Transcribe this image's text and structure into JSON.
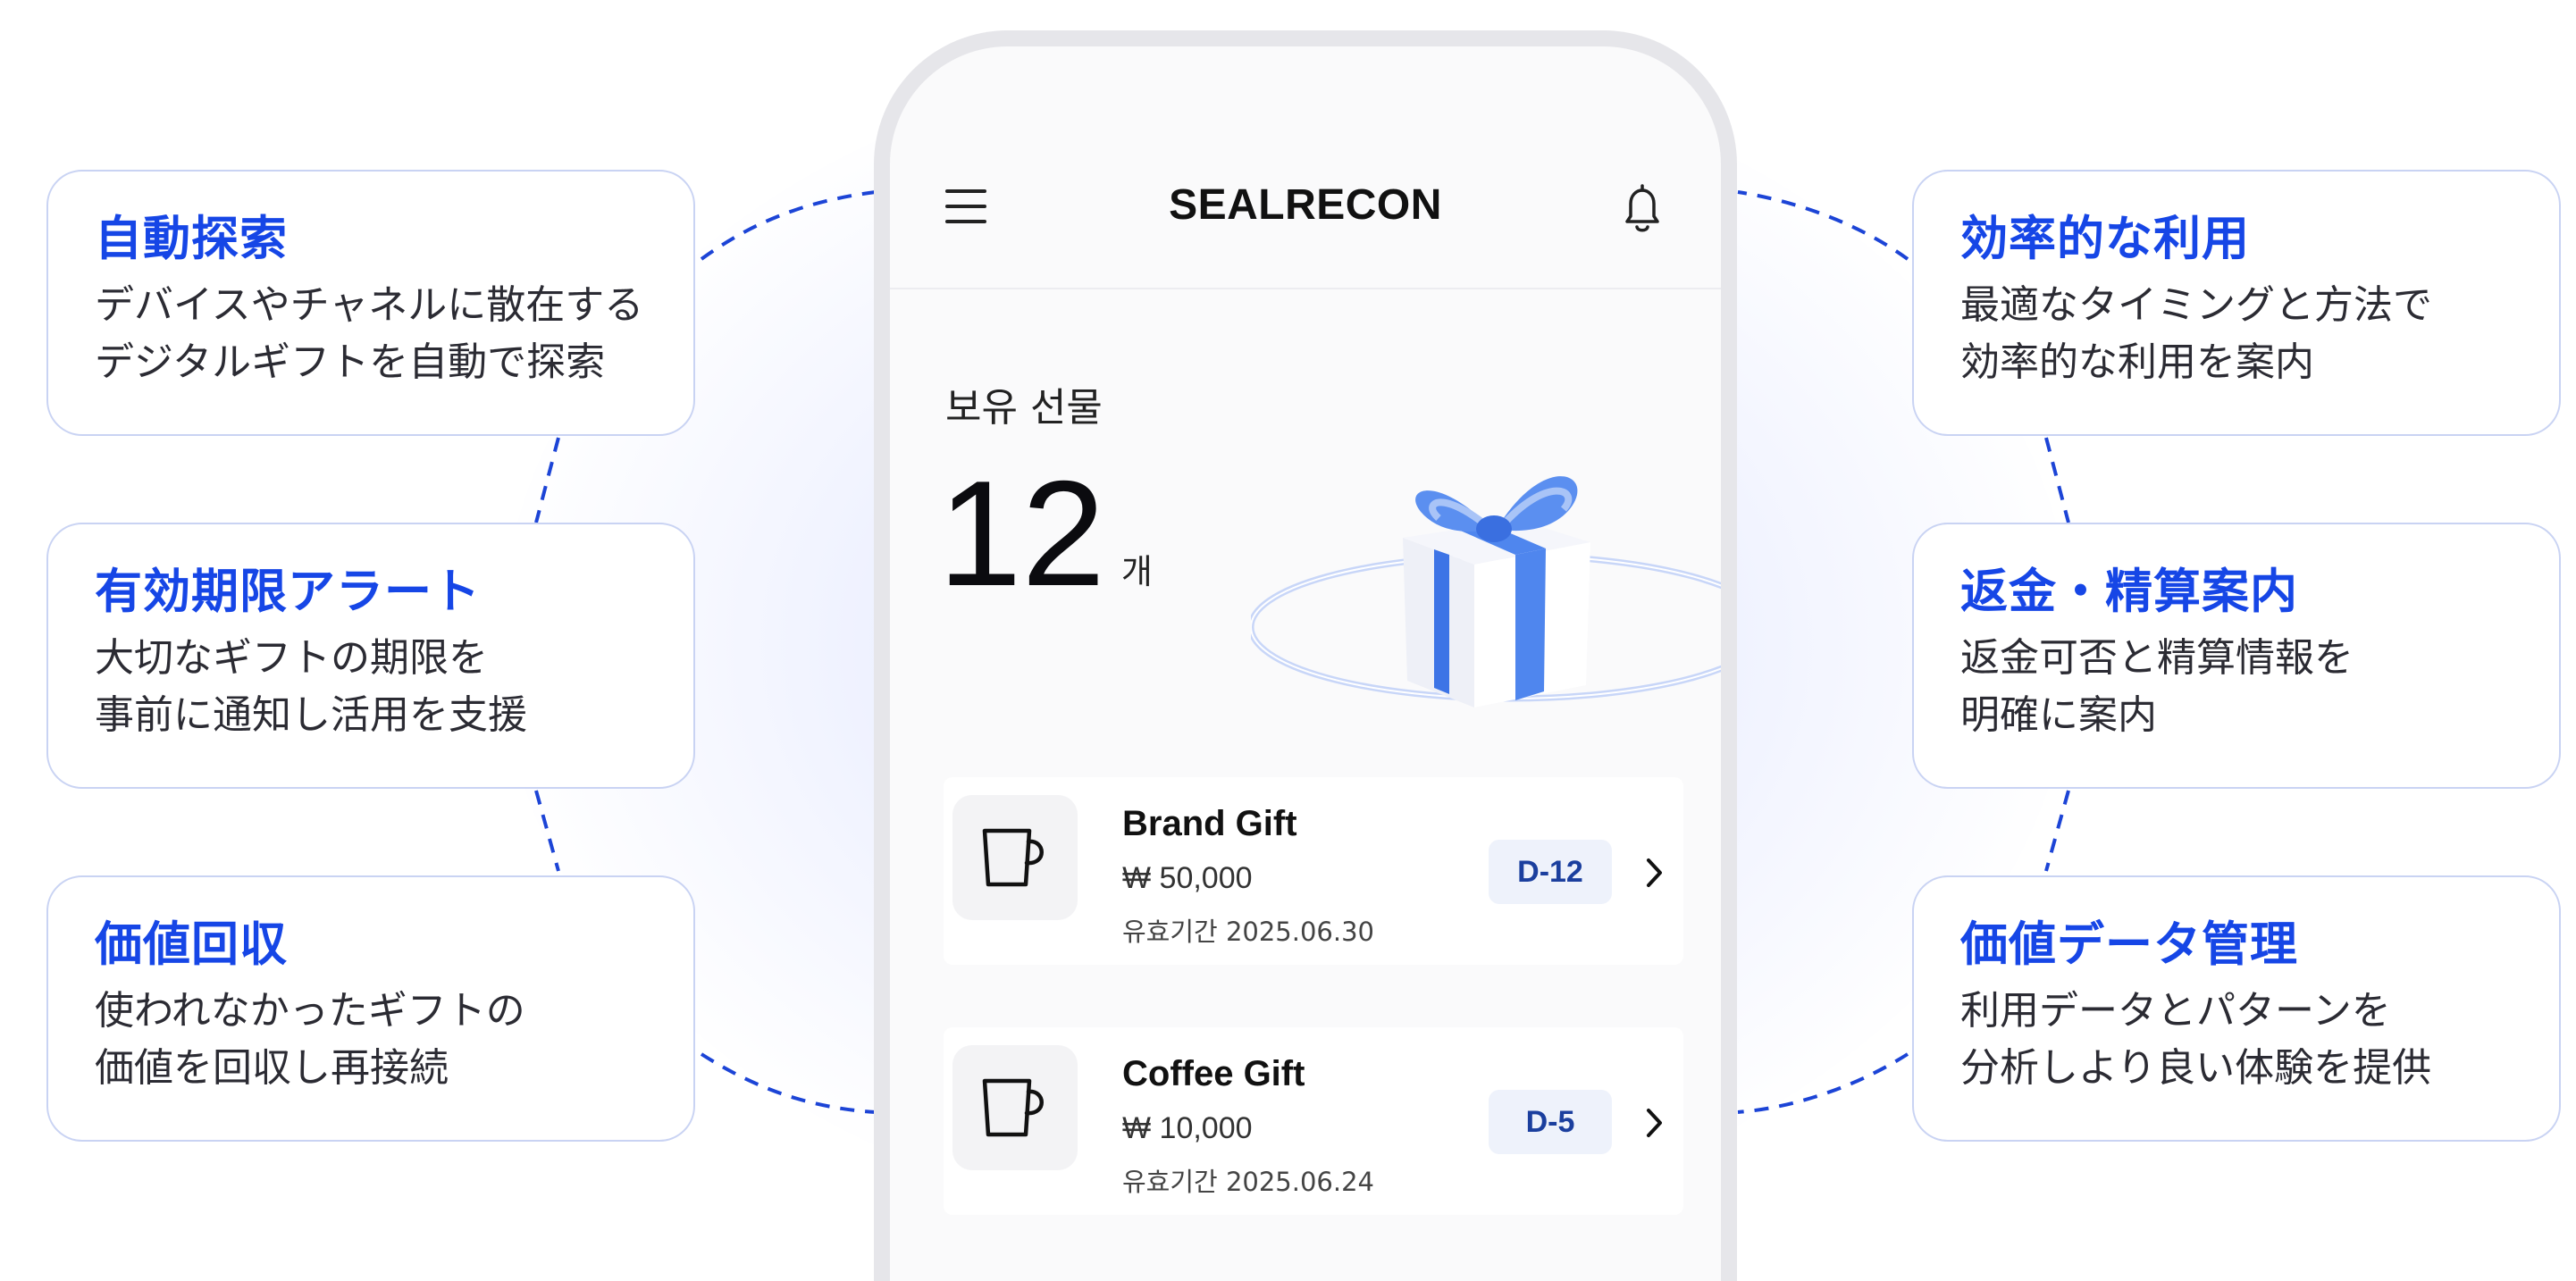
{
  "features_left": [
    {
      "title": "自動探索",
      "description": "デバイスやチャネルに散在する\nデジタルギフトを自動で探索"
    },
    {
      "title": "有効期限アラート",
      "description": "大切なギフトの期限を\n事前に通知し活用を支援"
    },
    {
      "title": "価値回収",
      "description": "使われなかったギフトの\n価値を回収し再接続"
    }
  ],
  "features_right": [
    {
      "title": "効率的な利用",
      "description": "最適なタイミングと方法で\n効率的な利用を案内"
    },
    {
      "title": "返金・精算案内",
      "description": "返金可否と精算情報を\n明確に案内"
    },
    {
      "title": "価値データ管理",
      "description": "利用データとパターンを\n分析しより良い体験を提供"
    }
  ],
  "phone": {
    "header": {
      "title": "SEALRECON",
      "menu_icon": "menu-icon",
      "bell_icon": "bell-icon"
    },
    "summary": {
      "label": "보유 선물",
      "count": "12",
      "unit": "개",
      "illustration": "gift-box-illustration"
    },
    "gifts": [
      {
        "name": "Brand Gift",
        "price": "₩ 50,000",
        "expiry": "유효기간 2025.06.30",
        "dday": "D-12",
        "icon": "cup-icon"
      },
      {
        "name": "Coffee Gift",
        "price": "₩ 10,000",
        "expiry": "유효기간 2025.06.24",
        "dday": "D-5",
        "icon": "cup-icon"
      }
    ]
  },
  "colors": {
    "accent": "#1646e6",
    "card_border": "#c9d3f3",
    "connector": "#1c44d6",
    "ribbon": "#4f86ee",
    "dday_bg": "#eef2fb"
  }
}
